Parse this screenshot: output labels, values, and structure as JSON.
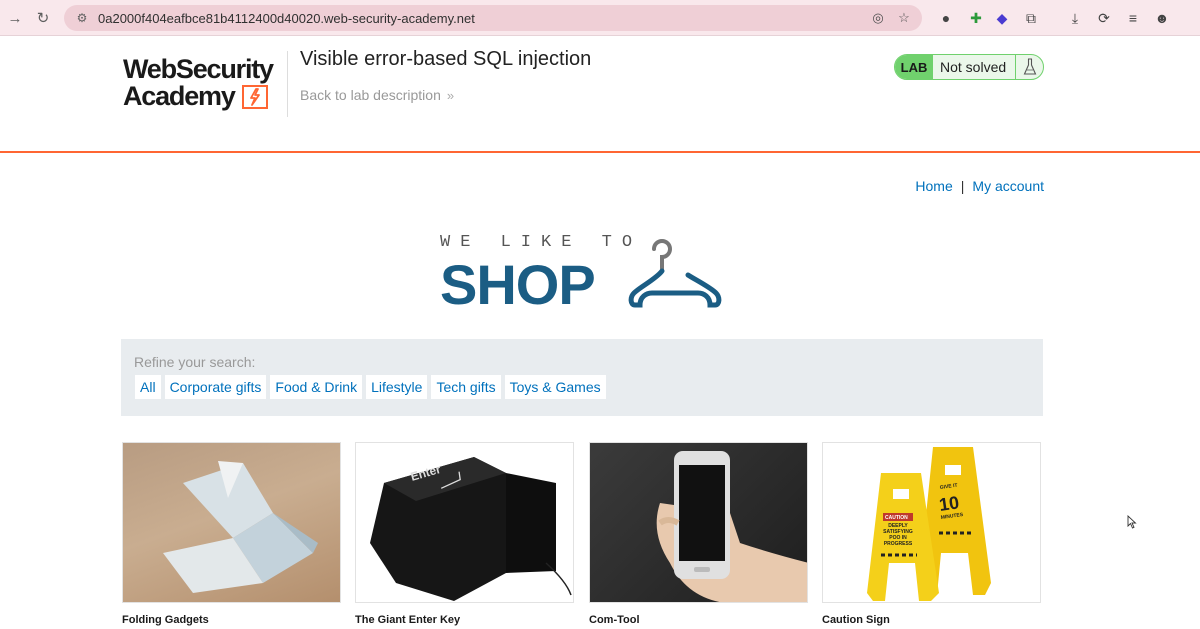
{
  "browser": {
    "url": "0a2000f404eafbce81b4112400d40020.web-security-academy.net"
  },
  "logo": {
    "line1": "WebSecurity",
    "line2": "Academy"
  },
  "lab": {
    "title": "Visible error-based SQL injection",
    "back_link": "Back to lab description",
    "badge": "LAB",
    "status": "Not solved"
  },
  "nav": {
    "home": "Home",
    "separator": "|",
    "account": "My account"
  },
  "banner": {
    "tagline": "WE LIKE TO",
    "word": "SHOP"
  },
  "filter": {
    "label": "Refine your search:",
    "categories": [
      "All",
      "Corporate gifts",
      "Food & Drink",
      "Lifestyle",
      "Tech gifts",
      "Toys & Games"
    ]
  },
  "products": [
    {
      "name": "Folding Gadgets"
    },
    {
      "name": "The Giant Enter Key",
      "image_text": "Enter"
    },
    {
      "name": "Com-Tool"
    },
    {
      "name": "Caution Sign",
      "image_text_1": "CAUTION",
      "image_text_2": "DEEPLY SATISFYING POO IN PROGRESS",
      "image_text_3": "GIVE IT",
      "image_text_4": "10",
      "image_text_5": "MINUTES"
    }
  ],
  "colors": {
    "accent": "#ff6633",
    "link": "#0071bc",
    "shop_blue": "#1b5d84",
    "lab_green": "#70d16d"
  }
}
